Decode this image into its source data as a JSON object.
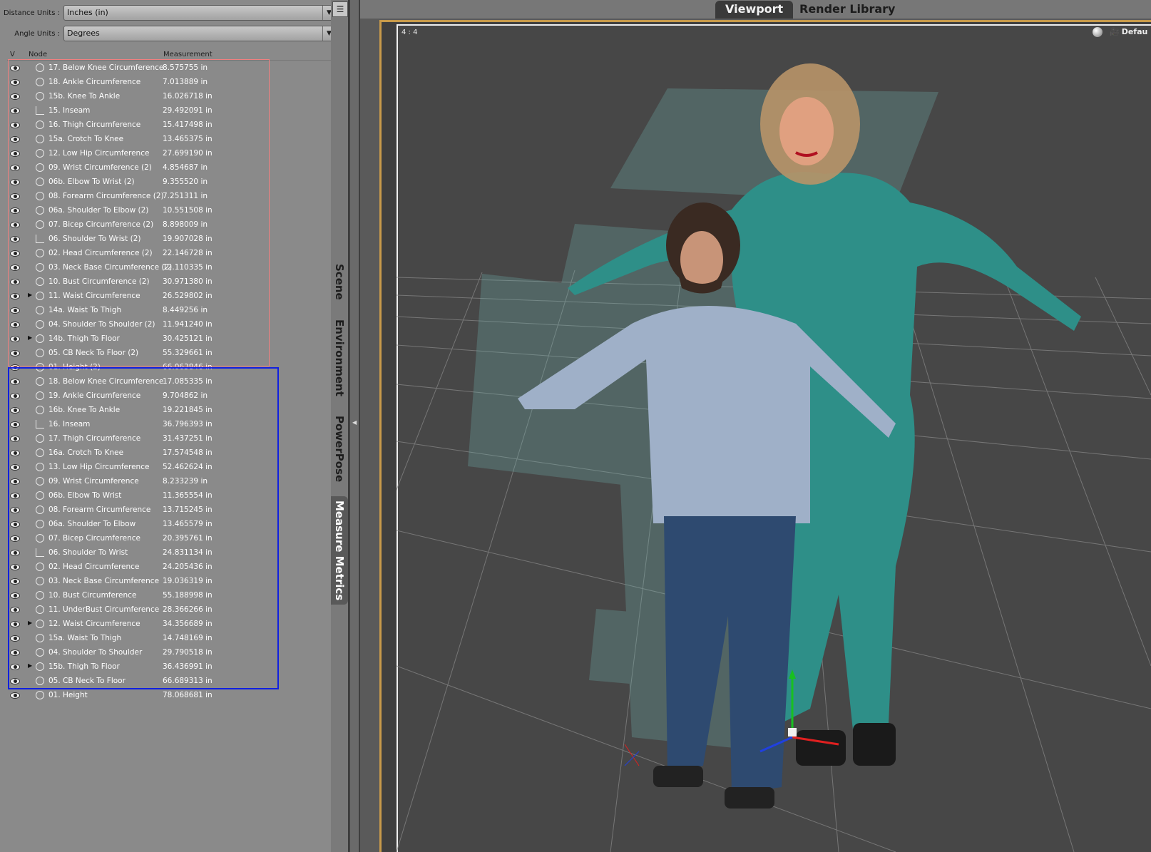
{
  "units": {
    "distance_label": "Distance Units :",
    "distance_value": "Inches (in)",
    "angle_label": "Angle Units :",
    "angle_value": "Degrees"
  },
  "columns": {
    "visible": "V",
    "node": "Node",
    "measurement": "Measurement"
  },
  "nodes": [
    {
      "label": "17. Below Knee Circumference",
      "value": "8.575755 in",
      "icon": "circumference-icon",
      "expandable": false
    },
    {
      "label": "18. Ankle Circumference",
      "value": "7.013889 in",
      "icon": "circumference-icon",
      "expandable": false
    },
    {
      "label": "15b. Knee To Ankle",
      "value": "16.026718 in",
      "icon": "tape-icon",
      "expandable": false
    },
    {
      "label": "15. Inseam",
      "value": "29.492091 in",
      "icon": "ruler-icon",
      "expandable": false
    },
    {
      "label": "16. Thigh Circumference",
      "value": "15.417498 in",
      "icon": "circumference-icon",
      "expandable": false
    },
    {
      "label": "15a. Crotch To Knee",
      "value": "13.465375 in",
      "icon": "tape-icon",
      "expandable": false
    },
    {
      "label": "12. Low Hip Circumference",
      "value": "27.699190 in",
      "icon": "circumference-icon",
      "expandable": false
    },
    {
      "label": "09. Wrist Circumference (2)",
      "value": "4.854687 in",
      "icon": "circumference-icon",
      "expandable": false
    },
    {
      "label": "06b. Elbow To Wrist (2)",
      "value": "9.355520 in",
      "icon": "tape-icon",
      "expandable": false
    },
    {
      "label": "08. Forearm Circumference (2)",
      "value": "7.251311 in",
      "icon": "circumference-icon",
      "expandable": false
    },
    {
      "label": "06a. Shoulder To Elbow (2)",
      "value": "10.551508 in",
      "icon": "tape-icon",
      "expandable": false
    },
    {
      "label": "07. Bicep Circumference (2)",
      "value": "8.898009 in",
      "icon": "circumference-icon",
      "expandable": false
    },
    {
      "label": "06. Shoulder To Wrist (2)",
      "value": "19.907028 in",
      "icon": "ruler-icon",
      "expandable": false
    },
    {
      "label": "02. Head Circumference (2)",
      "value": "22.146728 in",
      "icon": "circumference-icon",
      "expandable": false
    },
    {
      "label": "03. Neck Base Circumference (2)",
      "value": "12.110335 in",
      "icon": "circumference-icon",
      "expandable": false
    },
    {
      "label": "10. Bust Circumference (2)",
      "value": "30.971380 in",
      "icon": "circumference-icon",
      "expandable": false
    },
    {
      "label": "11. Waist Circumference",
      "value": "26.529802 in",
      "icon": "circumference-icon",
      "expandable": true
    },
    {
      "label": "14a. Waist To Thigh",
      "value": "8.449256 in",
      "icon": "tape-icon",
      "expandable": false
    },
    {
      "label": "04. Shoulder To Shoulder (2)",
      "value": "11.941240 in",
      "icon": "circumference-icon",
      "expandable": false
    },
    {
      "label": "14b. Thigh To Floor",
      "value": "30.425121 in",
      "icon": "tape-icon",
      "expandable": true
    },
    {
      "label": "05. CB Neck To Floor (2)",
      "value": "55.329661 in",
      "icon": "tape-icon",
      "expandable": false
    },
    {
      "label": "01. Height (2)",
      "value": "66.063846 in",
      "icon": "tape-icon",
      "expandable": false
    },
    {
      "label": "18. Below Knee Circumference",
      "value": "17.085335 in",
      "icon": "circumference-icon",
      "expandable": false
    },
    {
      "label": "19. Ankle Circumference",
      "value": "9.704862 in",
      "icon": "circumference-icon",
      "expandable": false
    },
    {
      "label": "16b. Knee To Ankle",
      "value": "19.221845 in",
      "icon": "tape-icon",
      "expandable": false
    },
    {
      "label": "16. Inseam",
      "value": "36.796393 in",
      "icon": "ruler-icon",
      "expandable": false
    },
    {
      "label": "17. Thigh Circumference",
      "value": "31.437251 in",
      "icon": "circumference-icon",
      "expandable": false
    },
    {
      "label": "16a. Crotch To Knee",
      "value": "17.574548 in",
      "icon": "tape-icon",
      "expandable": false
    },
    {
      "label": "13. Low Hip Circumference",
      "value": "52.462624 in",
      "icon": "circumference-icon",
      "expandable": false
    },
    {
      "label": "09. Wrist Circumference",
      "value": "8.233239 in",
      "icon": "circumference-icon",
      "expandable": false
    },
    {
      "label": "06b. Elbow To Wrist",
      "value": "11.365554 in",
      "icon": "tape-icon",
      "expandable": false
    },
    {
      "label": "08. Forearm Circumference",
      "value": "13.715245 in",
      "icon": "circumference-icon",
      "expandable": false
    },
    {
      "label": "06a. Shoulder To Elbow",
      "value": "13.465579 in",
      "icon": "tape-icon",
      "expandable": false
    },
    {
      "label": "07. Bicep Circumference",
      "value": "20.395761 in",
      "icon": "circumference-icon",
      "expandable": false
    },
    {
      "label": "06. Shoulder To Wrist",
      "value": "24.831134 in",
      "icon": "ruler-icon",
      "expandable": false
    },
    {
      "label": "02. Head Circumference",
      "value": "24.205436 in",
      "icon": "circumference-icon",
      "expandable": false
    },
    {
      "label": "03. Neck Base Circumference",
      "value": "19.036319 in",
      "icon": "circumference-icon",
      "expandable": false
    },
    {
      "label": "10. Bust Circumference",
      "value": "55.188998 in",
      "icon": "circumference-icon",
      "expandable": false
    },
    {
      "label": "11. UnderBust Circumference",
      "value": "28.366266 in",
      "icon": "circumference-icon",
      "expandable": false
    },
    {
      "label": "12. Waist Circumference",
      "value": "34.356689 in",
      "icon": "circumference-icon",
      "expandable": true
    },
    {
      "label": "15a. Waist To Thigh",
      "value": "14.748169 in",
      "icon": "tape-icon",
      "expandable": false
    },
    {
      "label": "04. Shoulder To Shoulder",
      "value": "29.790518 in",
      "icon": "circumference-icon",
      "expandable": false
    },
    {
      "label": "15b. Thigh To Floor",
      "value": "36.436991 in",
      "icon": "tape-icon",
      "expandable": true
    },
    {
      "label": "05. CB Neck To Floor",
      "value": "66.689313 in",
      "icon": "tape-icon",
      "expandable": false
    },
    {
      "label": "01. Height",
      "value": "78.068681 in",
      "icon": "tape-icon",
      "expandable": false
    }
  ],
  "side_tabs": [
    {
      "label": "Scene",
      "active": false
    },
    {
      "label": "Environment",
      "active": false
    },
    {
      "label": "PowerPose",
      "active": false
    },
    {
      "label": "Measure Metrics",
      "active": true
    }
  ],
  "viewport_tabs": [
    {
      "label": "Viewport",
      "active": true
    },
    {
      "label": "Render Library",
      "active": false
    }
  ],
  "viewport": {
    "aspect_label": "4 : 4",
    "camera_label": "Defau"
  },
  "colors": {
    "panel_bg": "#8a8a8a",
    "group_one_border": "#f08080",
    "group_two_border": "#1020e0",
    "viewport_frame": "#c89a4a",
    "scrubs_teal": "#2e8f88"
  }
}
